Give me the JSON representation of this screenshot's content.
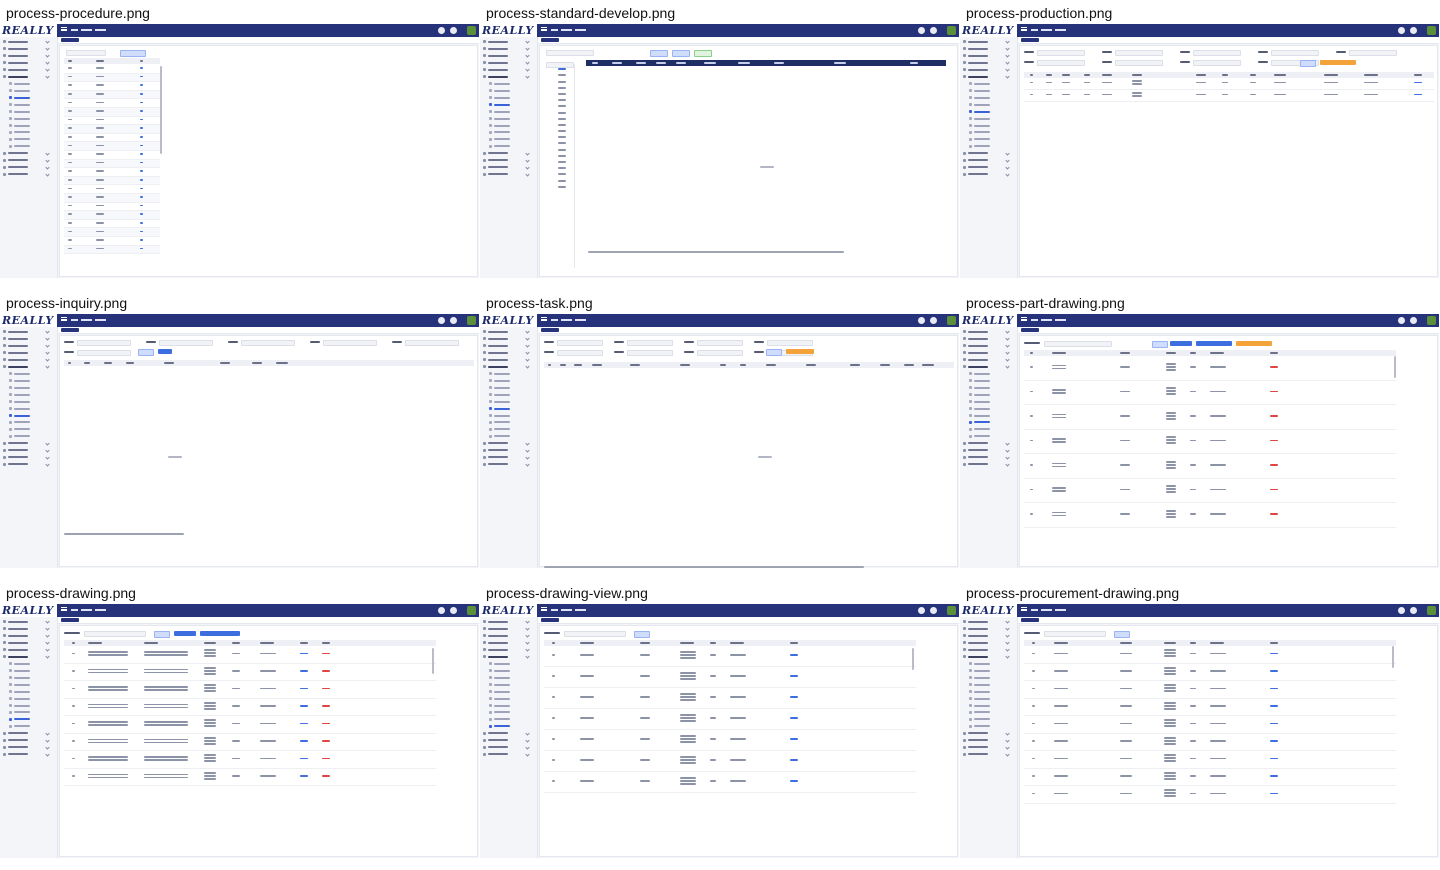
{
  "tiles": [
    {
      "name": "process-procedure.png",
      "layout": "procedure"
    },
    {
      "name": "process-standard-develop.png",
      "layout": "standard"
    },
    {
      "name": "process-production.png",
      "layout": "production"
    },
    {
      "name": "process-inquiry.png",
      "layout": "inquiry"
    },
    {
      "name": "process-task.png",
      "layout": "task"
    },
    {
      "name": "process-part-drawing.png",
      "layout": "part"
    },
    {
      "name": "process-drawing.png",
      "layout": "drawing"
    },
    {
      "name": "process-drawing-view.png",
      "layout": "view"
    },
    {
      "name": "process-procurement-drawing.png",
      "layout": "procurement"
    }
  ],
  "app": {
    "logo_text": "REALLY",
    "brand_color": "#26337a",
    "accent_color": "#3d6ee0",
    "warning_color": "#f4a23a",
    "danger_color": "#e04545"
  },
  "active_menu_row": {
    "procedure": 8,
    "standard": 9,
    "production": 10,
    "inquiry": 12,
    "task": 11,
    "part": 13,
    "drawing": 14,
    "view": 15,
    "procurement": 16
  }
}
